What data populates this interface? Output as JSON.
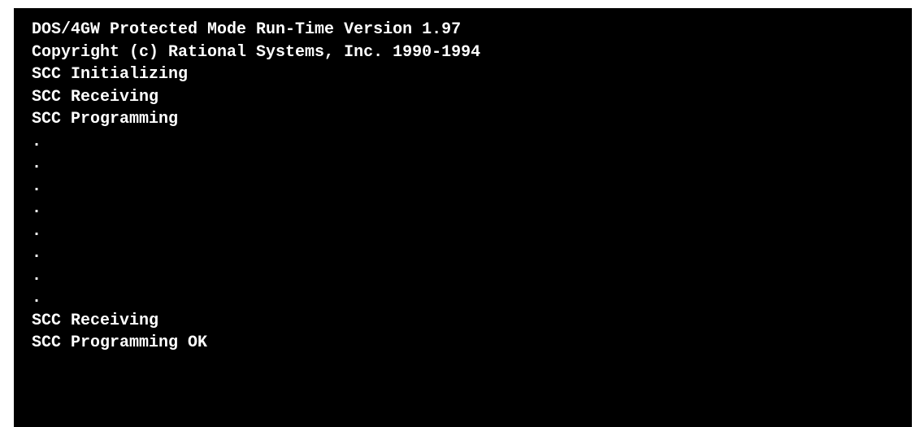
{
  "terminal": {
    "background_color": "#000000",
    "text_color": "#ffffff",
    "lines": [
      "DOS/4GW Protected Mode Run-Time Version 1.97",
      "Copyright (c) Rational Systems, Inc. 1990-1994",
      "SCC Initializing",
      "SCC Receiving",
      "SCC Programming",
      ".",
      ".",
      ".",
      ".",
      ".",
      ".",
      ".",
      ".",
      "SCC Receiving",
      "SCC Programming OK"
    ]
  }
}
